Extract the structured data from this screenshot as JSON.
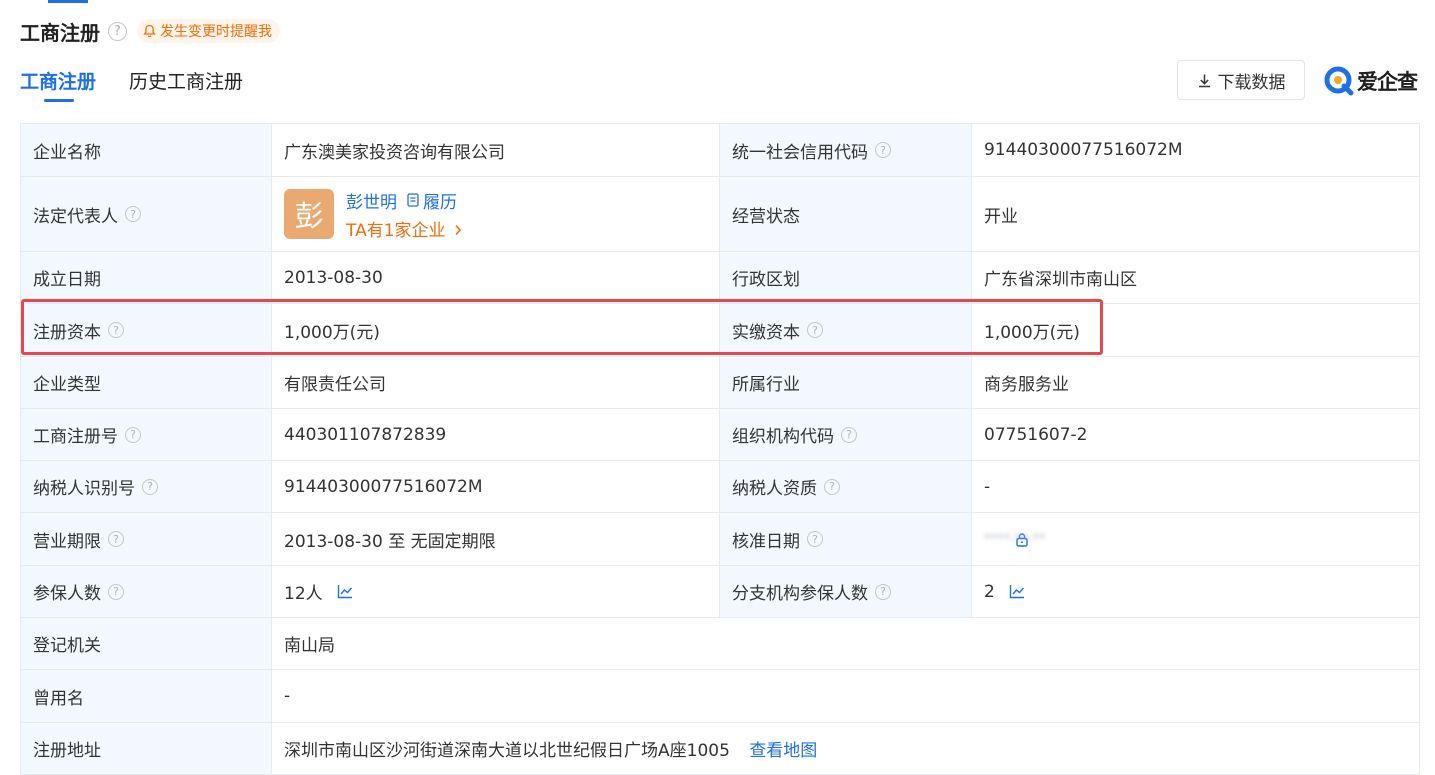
{
  "header": {
    "title": "工商注册",
    "help_icon": "question-circle-icon",
    "remind_label": "发生变更时提醒我",
    "remind_icon": "bell-icon"
  },
  "tabs": [
    {
      "label": "工商注册",
      "active": true
    },
    {
      "label": "历史工商注册",
      "active": false
    }
  ],
  "toolbar": {
    "download_label": "下载数据",
    "download_icon": "download-icon",
    "logo_text": "爱企查"
  },
  "colors": {
    "accent": "#1f6fe5",
    "orange": "#f06e0c",
    "label_bg": "#f3f8fe",
    "highlight": "#e8474f"
  },
  "rows": [
    {
      "l1": "企业名称",
      "v1": "广东澳美家投资咨询有限公司",
      "l2": "统一社会信用代码",
      "v2": "91440300077516072M"
    },
    {
      "l1": "法定代表人",
      "rep": {
        "avatar_char": "彭",
        "name": "彭世明",
        "resume_label": "履历",
        "company_link": "TA有1家企业"
      },
      "l2": "经营状态",
      "v2": "开业"
    },
    {
      "l1": "成立日期",
      "v1": "2013-08-30",
      "l2": "行政区划",
      "v2": "广东省深圳市南山区"
    },
    {
      "l1": "注册资本",
      "v1": "1,000万(元)",
      "l2": "实缴资本",
      "v2": "1,000万(元)"
    },
    {
      "l1": "企业类型",
      "v1": "有限责任公司",
      "l2": "所属行业",
      "v2": "商务服务业"
    },
    {
      "l1": "工商注册号",
      "v1": "440301107872839",
      "l2": "组织机构代码",
      "v2": "07751607-2"
    },
    {
      "l1": "纳税人识别号",
      "v1": "91440300077516072M",
      "l2": "纳税人资质",
      "v2": "-"
    },
    {
      "l1": "营业期限",
      "v1": "2013-08-30 至 无固定期限",
      "l2": "核准日期",
      "v2_locked": "****-**-**"
    },
    {
      "l1": "参保人数",
      "v1": "12人",
      "l2": "分支机构参保人数",
      "v2": "2"
    },
    {
      "l1": "登记机关",
      "v1": "南山局"
    },
    {
      "l1": "曾用名",
      "v1": "-"
    },
    {
      "l1": "注册地址",
      "v1": "深圳市南山区沙河街道深南大道以北世纪假日广场A座1005",
      "map_link": "查看地图"
    }
  ]
}
